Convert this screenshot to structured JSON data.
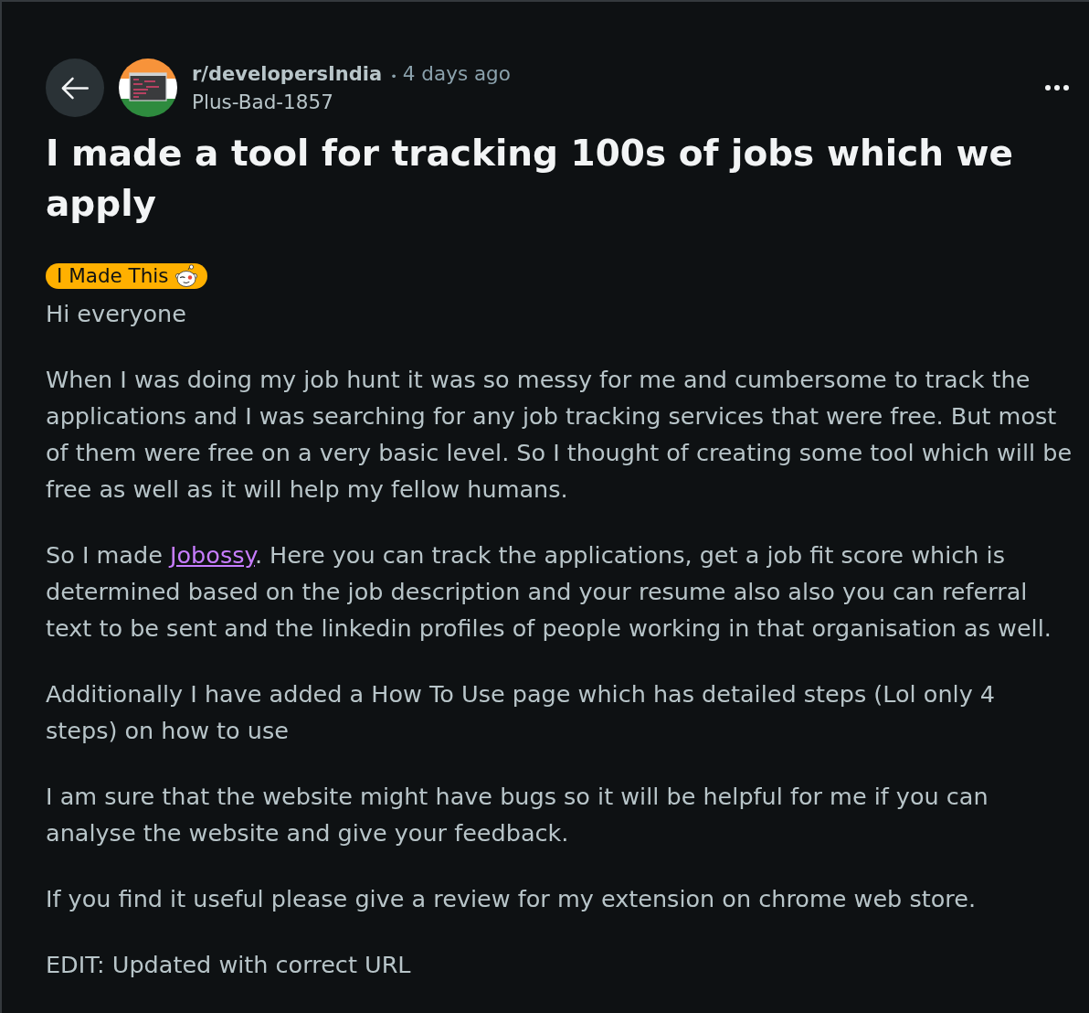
{
  "header": {
    "subreddit": "r/developersIndia",
    "separator": "•",
    "time": "4 days ago",
    "author": "Plus-Bad-1857"
  },
  "title": "I made a tool for tracking 100s of jobs which we apply",
  "flair": {
    "text": "I Made This"
  },
  "paragraphs": [
    {
      "segments": [
        {
          "kind": "text",
          "text": "Hi everyone"
        }
      ]
    },
    {
      "segments": [
        {
          "kind": "text",
          "text": "When I was doing my job hunt it was so messy for me and cumbersome to track the applications and I was searching for any job tracking services that were free. But most of them were free on a very basic level. So I thought of creating some tool which will be free as well as it will help my fellow humans."
        }
      ]
    },
    {
      "segments": [
        {
          "kind": "text",
          "text": "So I made "
        },
        {
          "kind": "link",
          "text": "Jobossy"
        },
        {
          "kind": "text",
          "text": ". Here you can track the applications, get a job fit score which is determined based on the job description and your resume also also you can referral text to be sent and the linkedin profiles of people working in that organisation as well."
        }
      ]
    },
    {
      "segments": [
        {
          "kind": "text",
          "text": "Additionally I have added a How To Use page which has detailed steps (Lol only 4 steps) on how to use"
        }
      ]
    },
    {
      "segments": [
        {
          "kind": "text",
          "text": "I am sure that the website might have bugs so it will be helpful for me if you can analyse the website and give your feedback."
        }
      ]
    },
    {
      "segments": [
        {
          "kind": "text",
          "text": "If you find it useful please give a review for my extension on chrome web store."
        }
      ]
    },
    {
      "segments": [
        {
          "kind": "text",
          "text": "EDIT: Updated with correct URL"
        }
      ]
    }
  ]
}
